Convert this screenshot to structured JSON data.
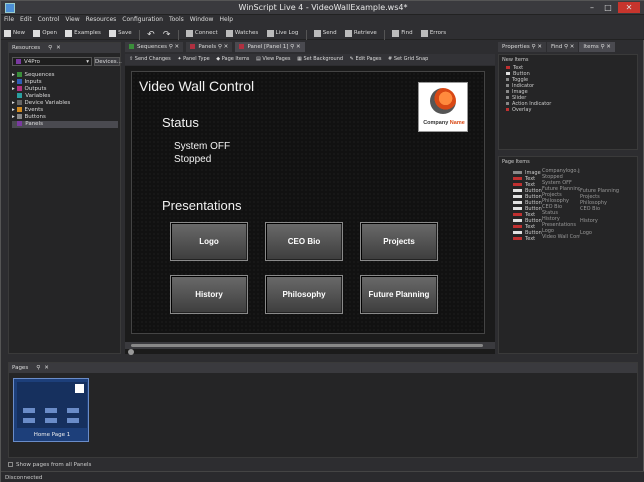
{
  "window": {
    "title": "WinScript Live 4 - VideoWallExample.ws4*"
  },
  "menu": [
    "File",
    "Edit",
    "Control",
    "View",
    "Resources",
    "Configuration",
    "Tools",
    "Window",
    "Help"
  ],
  "toolbar": {
    "new": "New",
    "open": "Open",
    "examples": "Examples",
    "save": "Save",
    "connect": "Connect",
    "watches": "Watches",
    "live_log": "Live Log",
    "send": "Send",
    "retrieve": "Retrieve",
    "find": "Find",
    "errors": "Errors"
  },
  "resources": {
    "title": "Resources",
    "system_value": "V4Pro",
    "devices_button": "Devices...",
    "tree": [
      {
        "label": "Sequences",
        "color": "#3a8e3a"
      },
      {
        "label": "Inputs",
        "color": "#2f5fb8"
      },
      {
        "label": "Outputs",
        "color": "#b03080"
      },
      {
        "label": "Variables",
        "color": "#2a9fa0"
      },
      {
        "label": "Device Variables",
        "color": "#666666"
      },
      {
        "label": "Events",
        "color": "#d08a20"
      },
      {
        "label": "Buttons",
        "color": "#888888"
      },
      {
        "label": "Panels",
        "color": "#7a3aa0"
      }
    ]
  },
  "tabs": [
    {
      "label": "Sequences",
      "color": "#3a8e3a"
    },
    {
      "label": "Panels",
      "color": "#b03040"
    },
    {
      "label": "Panel [Panel 1]",
      "color": "#b03040"
    }
  ],
  "panel_toolbar": {
    "send_changes": "Send Changes",
    "panel_type": "Panel Type",
    "page_items": "Page Items",
    "view_pages": "View Pages",
    "set_background": "Set Background",
    "edit_pages": "Edit Pages",
    "set_grid_snap": "Set Grid Snap"
  },
  "canvas": {
    "title": "Video Wall Control",
    "status_heading": "Status",
    "system_off": "System OFF",
    "stopped": "Stopped",
    "presentations_heading": "Presentations",
    "logo_company": "Company",
    "logo_name": "Name",
    "buttons": [
      "Logo",
      "CEO Bio",
      "Projects",
      "History",
      "Philosophy",
      "Future Planning"
    ]
  },
  "right_tabs": [
    "Properties",
    "Find",
    "Items"
  ],
  "new_items": {
    "title": "New Items",
    "items": [
      {
        "label": "Text",
        "color": "#c03030"
      },
      {
        "label": "Button",
        "color": "#e0e0e0"
      },
      {
        "label": "Toggle",
        "color": "#888888"
      },
      {
        "label": "Indicator",
        "color": "#888888"
      },
      {
        "label": "Image",
        "color": "#888888"
      },
      {
        "label": "Slider",
        "color": "#888888"
      },
      {
        "label": "Action Indicator",
        "color": "#888888"
      },
      {
        "label": "Overlay",
        "color": "#c03030"
      }
    ]
  },
  "page_items": {
    "title": "Page Items",
    "rows": [
      {
        "type": "Image",
        "name": "Companylogo.jpg",
        "extra": "",
        "color": "#888888"
      },
      {
        "type": "Text",
        "name": "Stopped",
        "extra": "",
        "color": "#c03030"
      },
      {
        "type": "Text",
        "name": "System OFF",
        "extra": "",
        "color": "#c03030"
      },
      {
        "type": "Button",
        "name": "Future Planning",
        "extra": "Future Planning",
        "color": "#e0e0e0"
      },
      {
        "type": "Button",
        "name": "Projects",
        "extra": "Projects",
        "color": "#e0e0e0"
      },
      {
        "type": "Button",
        "name": "Philosophy",
        "extra": "Philosophy",
        "color": "#e0e0e0"
      },
      {
        "type": "Button",
        "name": "CEO Bio",
        "extra": "CEO Bio",
        "color": "#e0e0e0"
      },
      {
        "type": "Text",
        "name": "Status",
        "extra": "",
        "color": "#c03030"
      },
      {
        "type": "Button",
        "name": "History",
        "extra": "History",
        "color": "#e0e0e0"
      },
      {
        "type": "Text",
        "name": "Presentations",
        "extra": "",
        "color": "#c03030"
      },
      {
        "type": "Button",
        "name": "Logo",
        "extra": "Logo",
        "color": "#e0e0e0"
      },
      {
        "type": "Text",
        "name": "Video Wall Control",
        "extra": "",
        "color": "#c03030"
      }
    ]
  },
  "pages": {
    "title": "Pages",
    "thumb_label": "Home Page 1",
    "show_all": "Show pages from all Panels"
  },
  "status": "Disconnected"
}
